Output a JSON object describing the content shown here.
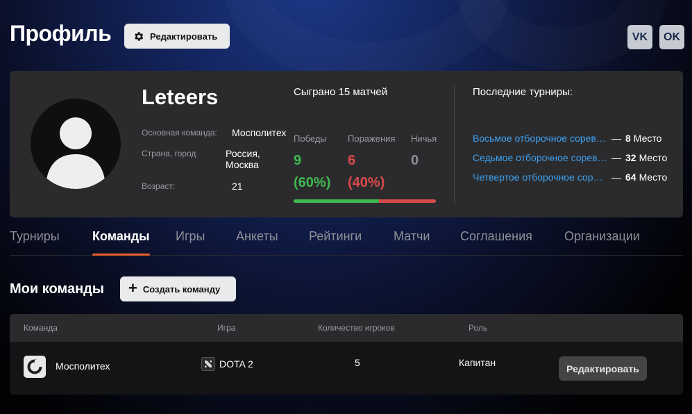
{
  "header": {
    "title": "Профиль",
    "edit_button": "Редактировать",
    "social": {
      "vk_label": "VK",
      "ok_label": "OK"
    }
  },
  "profile": {
    "nickname": "Leteers",
    "main_team_label": "Основная команда:",
    "main_team_value": "Мосполитех",
    "location_label": "Страна, город",
    "location_country": "Россия,",
    "location_city": "Москва",
    "age_label": "Возраст:",
    "age_value": "21"
  },
  "stats": {
    "matches_played": "Сыграно 15 матчей",
    "wins_label": "Победы",
    "wins_value": "9",
    "wins_percent": "(60%)",
    "losses_label": "Поражения",
    "losses_value": "6",
    "losses_percent": "(40%)",
    "draws_label": "Ничья",
    "draws_value": "0",
    "win_ratio": 0.6
  },
  "recent_tournaments": {
    "title": "Последние турниры:",
    "items": [
      {
        "name": "Восьмое отборочное соревнование",
        "dash": "—",
        "place": "8",
        "place_suffix": "Место"
      },
      {
        "name": "Седьмое отборочное соревнование",
        "dash": "—",
        "place": "32",
        "place_suffix": "Место"
      },
      {
        "name": "Четвертое отборочное соревнование",
        "dash": "—",
        "place": "64",
        "place_suffix": "Место"
      }
    ]
  },
  "tabs": [
    {
      "label": "Турниры",
      "active": false
    },
    {
      "label": "Команды",
      "active": true
    },
    {
      "label": "Игры",
      "active": false
    },
    {
      "label": "Анкеты",
      "active": false
    },
    {
      "label": "Рейтинги",
      "active": false
    },
    {
      "label": "Матчи",
      "active": false
    },
    {
      "label": "Соглашения",
      "active": false
    },
    {
      "label": "Организации",
      "active": false
    }
  ],
  "my_teams": {
    "title": "Мои команды",
    "create_button": "Создать команду",
    "columns": [
      "Команда",
      "Игра",
      "Количество игроков",
      "Роль"
    ],
    "rows": [
      {
        "team": "Мосполитех",
        "game": "DOTA 2",
        "players": "5",
        "role": "Капитан",
        "action": "Редактировать"
      }
    ]
  },
  "colors": {
    "accent_tab": "#e8632a",
    "win": "#3fb950",
    "loss": "#d94a4a",
    "link": "#3ea0f0"
  }
}
